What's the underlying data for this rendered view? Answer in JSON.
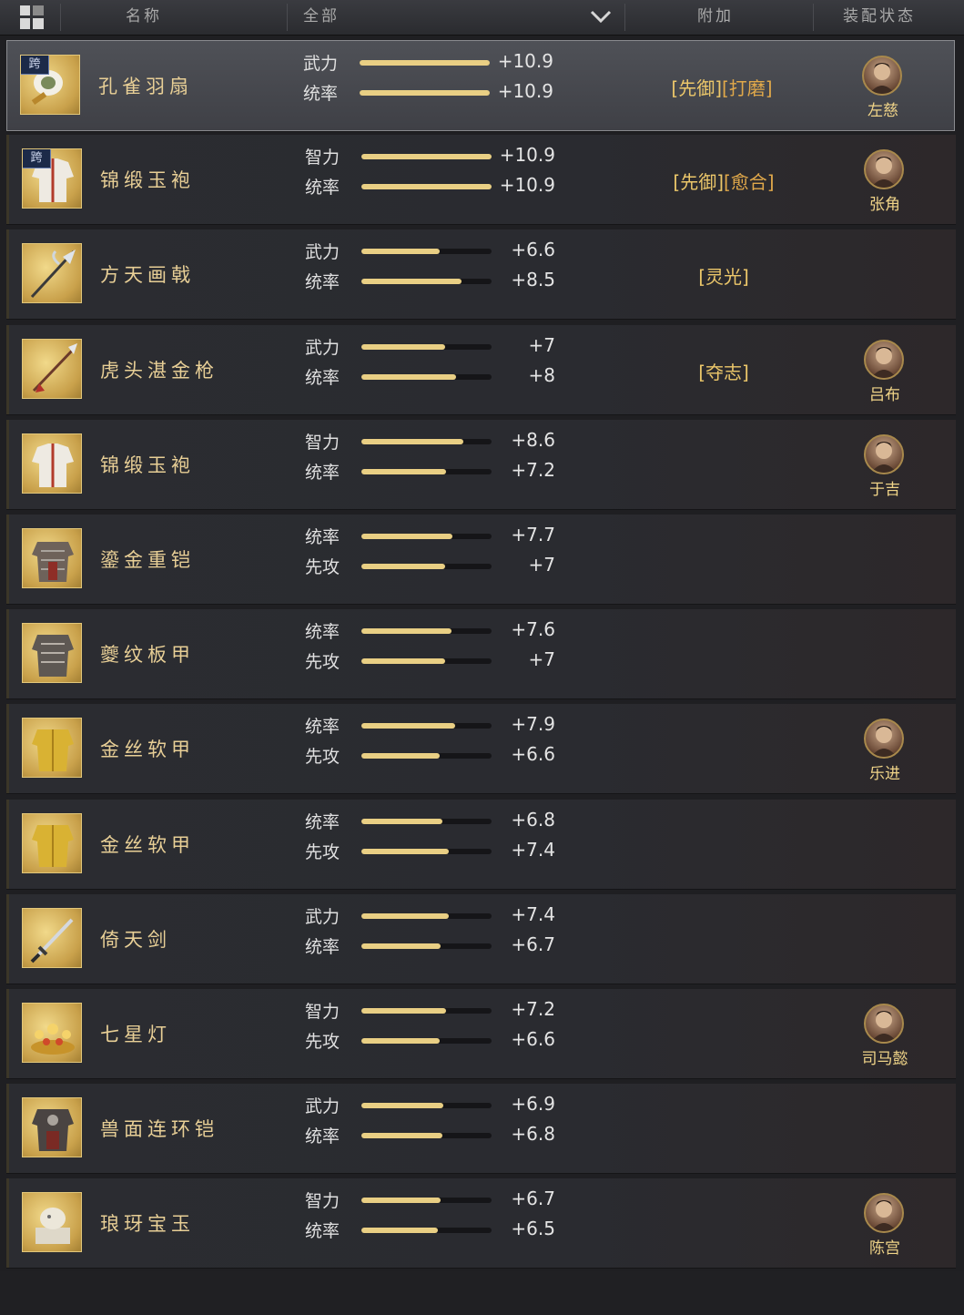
{
  "header": {
    "name_col": "名称",
    "filter_value": "全部",
    "extra_col": "附加",
    "status_col": "装配状态"
  },
  "items": [
    {
      "name": "孔雀羽扇",
      "icon": "feather-fan-icon",
      "cross": "跨",
      "stats": [
        {
          "label": "武力",
          "value": "+10.9",
          "fill": 1.0
        },
        {
          "label": "统率",
          "value": "+10.9",
          "fill": 1.0
        }
      ],
      "extras": [
        "[先御]",
        "[打磨]"
      ],
      "hero": "左慈",
      "selected": true
    },
    {
      "name": "锦缎玉袍",
      "icon": "robe-icon",
      "cross": "跨",
      "stats": [
        {
          "label": "智力",
          "value": "+10.9",
          "fill": 1.0
        },
        {
          "label": "统率",
          "value": "+10.9",
          "fill": 1.0
        }
      ],
      "extras": [
        "[先御]",
        "[愈合]"
      ],
      "hero": "张角"
    },
    {
      "name": "方天画戟",
      "icon": "halberd-icon",
      "cross": "",
      "stats": [
        {
          "label": "武力",
          "value": "+6.6",
          "fill": 0.6
        },
        {
          "label": "统率",
          "value": "+8.5",
          "fill": 0.77
        }
      ],
      "extras": [
        "[灵光]"
      ],
      "hero": ""
    },
    {
      "name": "虎头湛金枪",
      "icon": "spear-icon",
      "cross": "",
      "stats": [
        {
          "label": "武力",
          "value": "+7",
          "fill": 0.64
        },
        {
          "label": "统率",
          "value": "+8",
          "fill": 0.73
        }
      ],
      "extras": [
        "[夺志]"
      ],
      "hero": "吕布"
    },
    {
      "name": "锦缎玉袍",
      "icon": "robe-icon",
      "cross": "",
      "stats": [
        {
          "label": "智力",
          "value": "+8.6",
          "fill": 0.78
        },
        {
          "label": "统率",
          "value": "+7.2",
          "fill": 0.65
        }
      ],
      "extras": [],
      "hero": "于吉"
    },
    {
      "name": "鎏金重铠",
      "icon": "heavy-armor-icon",
      "cross": "",
      "stats": [
        {
          "label": "统率",
          "value": "+7.7",
          "fill": 0.7
        },
        {
          "label": "先攻",
          "value": "+7",
          "fill": 0.64
        }
      ],
      "extras": [],
      "hero": ""
    },
    {
      "name": "夔纹板甲",
      "icon": "plate-armor-icon",
      "cross": "",
      "stats": [
        {
          "label": "统率",
          "value": "+7.6",
          "fill": 0.69
        },
        {
          "label": "先攻",
          "value": "+7",
          "fill": 0.64
        }
      ],
      "extras": [],
      "hero": ""
    },
    {
      "name": "金丝软甲",
      "icon": "gold-armor-icon",
      "cross": "",
      "stats": [
        {
          "label": "统率",
          "value": "+7.9",
          "fill": 0.72
        },
        {
          "label": "先攻",
          "value": "+6.6",
          "fill": 0.6
        }
      ],
      "extras": [],
      "hero": "乐进"
    },
    {
      "name": "金丝软甲",
      "icon": "gold-armor-icon",
      "cross": "",
      "stats": [
        {
          "label": "统率",
          "value": "+6.8",
          "fill": 0.62
        },
        {
          "label": "先攻",
          "value": "+7.4",
          "fill": 0.67
        }
      ],
      "extras": [],
      "hero": ""
    },
    {
      "name": "倚天剑",
      "icon": "sword-icon",
      "cross": "",
      "stats": [
        {
          "label": "武力",
          "value": "+7.4",
          "fill": 0.67
        },
        {
          "label": "统率",
          "value": "+6.7",
          "fill": 0.61
        }
      ],
      "extras": [],
      "hero": ""
    },
    {
      "name": "七星灯",
      "icon": "lamp-icon",
      "cross": "",
      "stats": [
        {
          "label": "智力",
          "value": "+7.2",
          "fill": 0.65
        },
        {
          "label": "先攻",
          "value": "+6.6",
          "fill": 0.6
        }
      ],
      "extras": [],
      "hero": "司马懿"
    },
    {
      "name": "兽面连环铠",
      "icon": "chain-armor-icon",
      "cross": "",
      "stats": [
        {
          "label": "武力",
          "value": "+6.9",
          "fill": 0.63
        },
        {
          "label": "统率",
          "value": "+6.8",
          "fill": 0.62
        }
      ],
      "extras": [],
      "hero": ""
    },
    {
      "name": "琅玡宝玉",
      "icon": "jade-seal-icon",
      "cross": "",
      "stats": [
        {
          "label": "智力",
          "value": "+6.7",
          "fill": 0.61
        },
        {
          "label": "统率",
          "value": "+6.5",
          "fill": 0.59
        }
      ],
      "extras": [],
      "hero": "陈宫"
    }
  ]
}
